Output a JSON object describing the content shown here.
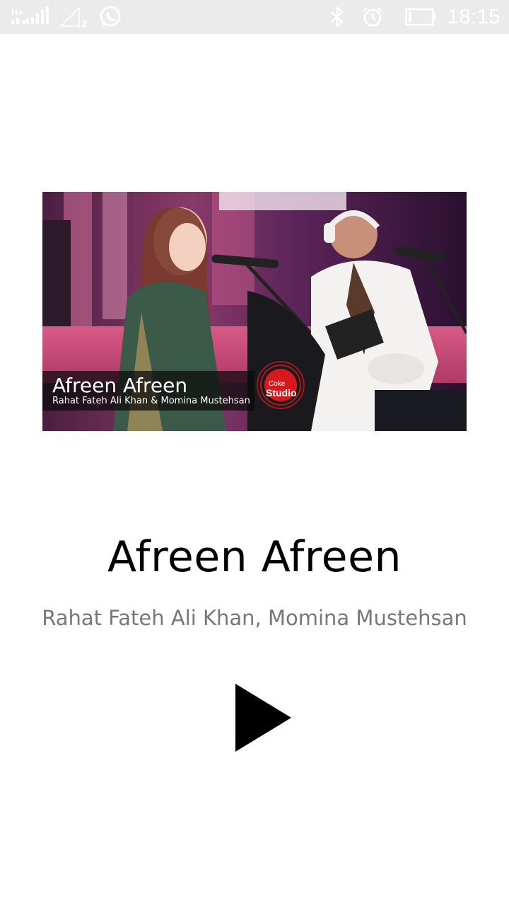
{
  "status_bar": {
    "network_type": "H+",
    "sim_slot": "2",
    "time": "18:15",
    "icons": [
      "signal-icon",
      "signal-empty-icon",
      "whatsapp-icon",
      "bluetooth-icon",
      "alarm-icon",
      "battery-icon"
    ]
  },
  "video": {
    "overlay_title": "Afreen Afreen",
    "overlay_subtitle": "Rahat Fateh Ali Khan & Momina Mustehsan",
    "logo_line1": "Coke",
    "logo_line2": "Studio"
  },
  "song": {
    "title": "Afreen Afreen",
    "artists": "Rahat Fateh Ali Khan, Momina Mustehsan"
  },
  "controls": {
    "play_icon": "play-icon"
  },
  "colors": {
    "status_bar_bg": "#ebebeb",
    "title_text": "#000000",
    "artist_text": "#777777",
    "logo_red": "#d7191f"
  }
}
